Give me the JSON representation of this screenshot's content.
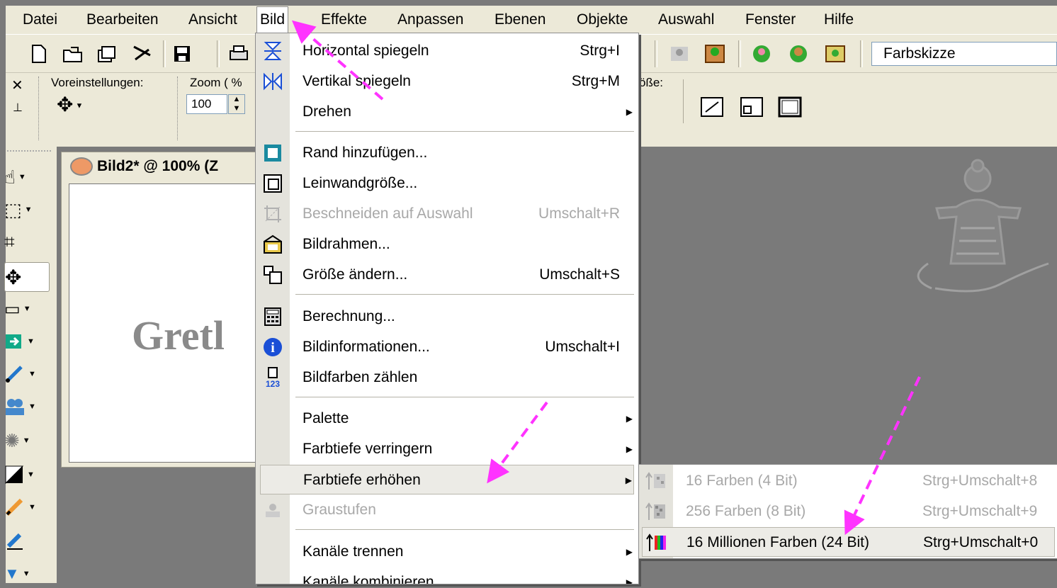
{
  "menubar": {
    "items": [
      {
        "label": "Datei"
      },
      {
        "label": "Bearbeiten"
      },
      {
        "label": "Ansicht"
      },
      {
        "label": "Bild"
      },
      {
        "label": "Effekte"
      },
      {
        "label": "Anpassen"
      },
      {
        "label": "Ebenen"
      },
      {
        "label": "Objekte"
      },
      {
        "label": "Auswahl"
      },
      {
        "label": "Fenster"
      },
      {
        "label": "Hilfe"
      }
    ],
    "active": "Bild"
  },
  "toolbar": {
    "preset_combo_value": "Farbskizze"
  },
  "tool_options": {
    "presets_label": "Voreinstellungen:",
    "zoom_label": "Zoom ( %",
    "zoom_value": "100",
    "size_label_partial": "öße:"
  },
  "image_window": {
    "title": "Bild2* @ 100% (Z",
    "canvas_text": "Gretl"
  },
  "bild_menu": {
    "items": [
      {
        "label": "Horizontal spiegeln",
        "shortcut": "Strg+I",
        "icon": "flip-horizontal-icon"
      },
      {
        "label": "Vertikal spiegeln",
        "shortcut": "Strg+M",
        "icon": "flip-vertical-icon"
      },
      {
        "label": "Drehen",
        "shortcut": "",
        "submenu": true
      },
      {
        "label": "Rand hinzufügen...",
        "shortcut": "",
        "icon": "add-border-icon"
      },
      {
        "label": "Leinwandgröße...",
        "shortcut": "",
        "icon": "canvas-size-icon"
      },
      {
        "label": "Beschneiden auf Auswahl",
        "shortcut": "Umschalt+R",
        "icon": "crop-icon",
        "disabled": true
      },
      {
        "label": "Bildrahmen...",
        "shortcut": "",
        "icon": "picture-frame-icon"
      },
      {
        "label": "Größe ändern...",
        "shortcut": "Umschalt+S",
        "icon": "resize-icon"
      },
      {
        "label": "Berechnung...",
        "shortcut": "",
        "icon": "calculator-icon"
      },
      {
        "label": "Bildinformationen...",
        "shortcut": "Umschalt+I",
        "icon": "info-icon"
      },
      {
        "label": "Bildfarben zählen",
        "shortcut": "",
        "icon": "count-colors-icon"
      },
      {
        "label": "Palette",
        "shortcut": "",
        "submenu": true
      },
      {
        "label": "Farbtiefe verringern",
        "shortcut": "",
        "submenu": true
      },
      {
        "label": "Farbtiefe erhöhen",
        "shortcut": "",
        "submenu": true,
        "highlighted": true
      },
      {
        "label": "Graustufen",
        "shortcut": "",
        "icon": "grayscale-icon",
        "disabled": true
      },
      {
        "label": "Kanäle trennen",
        "shortcut": "",
        "submenu": true
      },
      {
        "label": "Kanäle kombinieren",
        "shortcut": "",
        "submenu": true
      }
    ]
  },
  "color_depth_submenu": {
    "items": [
      {
        "label": "16 Farben (4 Bit)",
        "shortcut": "Strg+Umschalt+8",
        "disabled": true
      },
      {
        "label": "256 Farben (8 Bit)",
        "shortcut": "Strg+Umschalt+9",
        "disabled": true
      },
      {
        "label": "16 Millionen Farben (24 Bit)",
        "shortcut": "Strg+Umschalt+0",
        "highlighted": true
      }
    ]
  },
  "colors": {
    "annotation_arrow": "#ff33ff",
    "menu_bg": "#ece9d8",
    "workspace_bg": "#7a7a7a"
  }
}
